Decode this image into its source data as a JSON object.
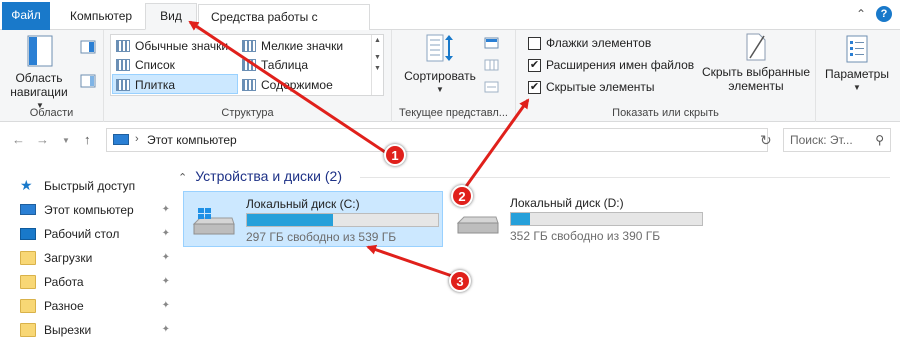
{
  "tabs": {
    "file": "Файл",
    "computer": "Компьютер",
    "view": "Вид",
    "disk_tools": "Средства работы с дисками"
  },
  "ribbon": {
    "areas": {
      "nav_pane_label": "Область навигации",
      "group_label": "Области"
    },
    "layout": {
      "items": [
        "Обычные значки",
        "Мелкие значки",
        "Список",
        "Таблица",
        "Плитка",
        "Содержимое"
      ],
      "selected": "Плитка",
      "group_label": "Структура"
    },
    "current_view": {
      "sort_label": "Сортировать",
      "group_label": "Текущее представл..."
    },
    "show_hide": {
      "checkboxes": [
        {
          "label": "Флажки элементов",
          "checked": false
        },
        {
          "label": "Расширения имен файлов",
          "checked": true
        },
        {
          "label": "Скрытые элементы",
          "checked": true
        }
      ],
      "hide_selected_label": "Скрыть выбранные элементы",
      "group_label": "Показать или скрыть"
    },
    "options": {
      "label": "Параметры"
    }
  },
  "address": {
    "path": "Этот компьютер",
    "search_placeholder": "Поиск: Эт..."
  },
  "sidebar": {
    "items": [
      {
        "label": "Быстрый доступ",
        "icon": "star-icon",
        "pinned": false
      },
      {
        "label": "Этот компьютер",
        "icon": "computer-icon",
        "pinned": true
      },
      {
        "label": "Рабочий стол",
        "icon": "desktop-icon",
        "pinned": true
      },
      {
        "label": "Загрузки",
        "icon": "folder-icon",
        "pinned": true
      },
      {
        "label": "Работа",
        "icon": "folder-icon",
        "pinned": true
      },
      {
        "label": "Разное",
        "icon": "folder-icon",
        "pinned": true
      },
      {
        "label": "Вырезки",
        "icon": "folder-icon",
        "pinned": true
      }
    ]
  },
  "content": {
    "section_title": "Устройства и диски (2)",
    "drives": [
      {
        "label": "Локальный диск (C:)",
        "free_text": "297 ГБ свободно из 539 ГБ",
        "used_fraction": 0.45,
        "selected": true
      },
      {
        "label": "Локальный диск (D:)",
        "free_text": "352 ГБ свободно из 390 ГБ",
        "used_fraction": 0.097,
        "selected": false
      }
    ]
  },
  "annotations": {
    "badges": [
      "1",
      "2",
      "3"
    ],
    "color": "#e0201b"
  },
  "colors": {
    "accent": "#1979ca",
    "selection": "#cce8ff",
    "progress": "#26a0da"
  }
}
